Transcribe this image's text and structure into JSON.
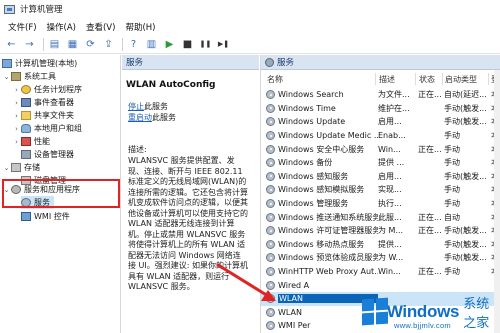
{
  "window": {
    "title": "计算机管理"
  },
  "menu": [
    "文件(F)",
    "操作(A)",
    "查看(V)",
    "帮助(H)"
  ],
  "toolbar": {
    "buttons": [
      "back-icon",
      "forward-icon",
      "up-icon",
      "show-hide-tree-icon",
      "refresh-icon",
      "export-icon",
      "help-icon",
      "properties-icon",
      "play-icon",
      "stop-icon",
      "pause-icon",
      "restart-icon"
    ],
    "glyphs": [
      "←",
      "→",
      "▤",
      "▦",
      "⟳",
      "⇪",
      "?",
      "▥",
      "▶",
      "■",
      "❚❚",
      "▶❚"
    ]
  },
  "tree": {
    "root": "计算机管理(本地)",
    "system_tools": "系统工具",
    "task_scheduler": "任务计划程序",
    "event_viewer": "事件查看器",
    "shared_folders": "共享文件夹",
    "local_users": "本地用户和组",
    "performance": "性能",
    "device_manager": "设备管理器",
    "storage": "存储",
    "disk_management": "磁盘管理",
    "services_apps": "服务和应用程序",
    "services": "服务",
    "wmi": "WMI 控件"
  },
  "middle": {
    "header": "服务",
    "service_title": "WLAN AutoConfig",
    "stop_link": "停止",
    "stop_suffix": "此服务",
    "restart_link": "重启动",
    "restart_suffix": "此服务",
    "desc_label": "描述:",
    "description": "WLANSVC 服务提供配置、发现、连接、断开与 IEEE 802.11 标准定义的无线局域网(WLAN)的连接所需的逻辑。它还包含将计算机变成软件访问点的逻辑，以便其他设备或计算机可以使用支持它的 WLAN 适配器无线连接到计算机。停止或禁用 WLANSVC 服务将使得计算机上的所有 WLAN 适配器无法访问 Windows 网络连接 UI。强烈建议: 如果你的计算机具有 WLAN 适配器，则运行 WLANSVC 服务。"
  },
  "list": {
    "tab": "服务",
    "columns": {
      "name": "名称",
      "desc": "描述",
      "status": "状态",
      "startup": "启动类型",
      "login": "登"
    },
    "rows": [
      {
        "name": "Windows Search",
        "desc": "为文件...",
        "status": "正在...",
        "startup": "自动(延迟...",
        "login": "本"
      },
      {
        "name": "Windows Time",
        "desc": "维护在...",
        "status": "",
        "startup": "手动(触发...",
        "login": "本"
      },
      {
        "name": "Windows Update",
        "desc": "启用...",
        "status": "",
        "startup": "手动(触发...",
        "login": "本"
      },
      {
        "name": "Windows Update Medic ...",
        "desc": "Enab...",
        "status": "",
        "startup": "手动",
        "login": "本"
      },
      {
        "name": "Windows 安全中心服务",
        "desc": "Win...",
        "status": "正在...",
        "startup": "手动",
        "login": "本"
      },
      {
        "name": "Windows 备份",
        "desc": "提供 ...",
        "status": "",
        "startup": "手动",
        "login": "本"
      },
      {
        "name": "Windows 感知服务",
        "desc": "启用...",
        "status": "",
        "startup": "手动(触发...",
        "login": "本"
      },
      {
        "name": "Windows 感知模拟服务",
        "desc": "实现...",
        "status": "",
        "startup": "手动",
        "login": "本"
      },
      {
        "name": "Windows 管理服务",
        "desc": "执行...",
        "status": "",
        "startup": "手动",
        "login": "本"
      },
      {
        "name": "Windows 推送通知系统服务",
        "desc": "此服...",
        "status": "正在...",
        "startup": "自动",
        "login": "本"
      },
      {
        "name": "Windows 许可证管理器服务",
        "desc": "为 M...",
        "status": "正在...",
        "startup": "手动(触发...",
        "login": "本"
      },
      {
        "name": "Windows 移动热点服务",
        "desc": "提供...",
        "status": "",
        "startup": "手动(触发...",
        "login": "本"
      },
      {
        "name": "Windows 预览体验成员服务",
        "desc": "为 W...",
        "status": "",
        "startup": "手动(触发...",
        "login": "本"
      },
      {
        "name": "WinHTTP Web Proxy Aut...",
        "desc": "Win...",
        "status": "正在...",
        "startup": "手动",
        "login": "本"
      },
      {
        "name": "Wired A",
        "desc": "",
        "status": "",
        "startup": "",
        "login": ""
      },
      {
        "name": "WLAN",
        "desc": "",
        "status": "",
        "startup": "",
        "login": ""
      },
      {
        "name": "WLAN",
        "desc": "",
        "status": "",
        "startup": "",
        "login": ""
      },
      {
        "name": "WMI Per",
        "desc": "",
        "status": "",
        "startup": "",
        "login": ""
      }
    ]
  },
  "watermark": {
    "brand": "Windows",
    "suffix": "系统之家",
    "url": "www.bjjmlv.com"
  },
  "colors": {
    "highlight_red": "#e02424",
    "selection_blue": "#0a64b8",
    "watermark_blue": "#0f6fc6"
  }
}
